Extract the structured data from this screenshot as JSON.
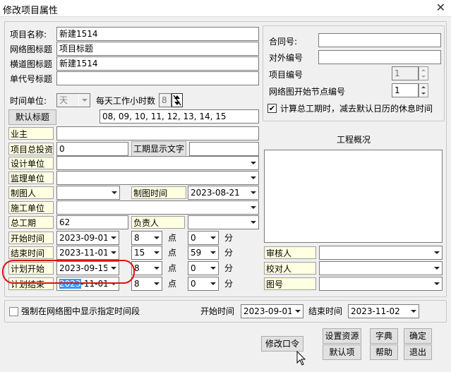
{
  "window": {
    "title": "修改项目属性",
    "close": "✕"
  },
  "left": {
    "project_name_label": "项目名称:",
    "project_name": "新建1514",
    "net_title_label": "网络图标题",
    "net_title": "项目标题",
    "horiz_title_label": "横道图标题",
    "horiz_title": "新建1514",
    "code_title_label": "单代号标题",
    "code_title": "",
    "time_unit_label": "时间单位:",
    "time_unit": "天",
    "hours_label": "每天工作小时数",
    "hours_value": "8",
    "default_title_button": "默认标题",
    "hours_list": "08, 09, 10, 11, 12, 13, 14, 15",
    "owner_label": "业主",
    "owner": "",
    "investment_label": "项目总投资",
    "investment": "0",
    "duration_text_button": "工期显示文字",
    "duration_text": "",
    "design_label": "设计单位",
    "design": "",
    "supervise_label": "监理单位",
    "supervise": "",
    "drawer_label": "制图人",
    "drawer": "",
    "draw_time_label": "制图时间",
    "draw_time": "2023-08-21",
    "construct_label": "施工单位",
    "construct": "",
    "total_label": "总工期",
    "total": "62",
    "manager_label": "负责人",
    "manager": "",
    "rows": [
      {
        "label": "开始时间",
        "date": "2023-09-01",
        "hour": "8",
        "point": "点",
        "minute": "0",
        "min_unit": "分"
      },
      {
        "label": "结束时间",
        "date": "2023-11-01",
        "hour": "15",
        "point": "点",
        "minute": "59",
        "min_unit": "分"
      },
      {
        "label": "计划开始",
        "date": "2023-09-15",
        "hour": "8",
        "point": "点",
        "minute": "0",
        "min_unit": "分"
      },
      {
        "label": "计划结束",
        "date_sel": "2023",
        "date_rest": "-11-01",
        "hour": "8",
        "point": "点",
        "minute": "0",
        "min_unit": "分"
      }
    ]
  },
  "right": {
    "contract_label": "合同号:",
    "contract": "",
    "external_label": "对外编号",
    "external": "",
    "project_no_label": "项目编号",
    "project_no": "1",
    "start_node_label": "网络图开始节点编号",
    "start_node": "1",
    "checkbox_label": "计算总工期时，减去默认日历的休息时间",
    "checkbox_mark": "✔",
    "overview_label": "工程概况",
    "reviewer_label": "审核人",
    "checker_label": "校对人",
    "drawing_no_label": "图号"
  },
  "bottom": {
    "force_label": "强制在网络图中显示指定时间段",
    "start_label": "开始时间",
    "start": "2023-09-01",
    "end_label": "结束时间",
    "end": "2023-11-02"
  },
  "buttons": {
    "modify_password": "修改口令",
    "set_resource": "设置资源",
    "dictionary": "字典",
    "ok": "确定",
    "default": "默认项",
    "help": "帮助",
    "exit": "退出"
  }
}
